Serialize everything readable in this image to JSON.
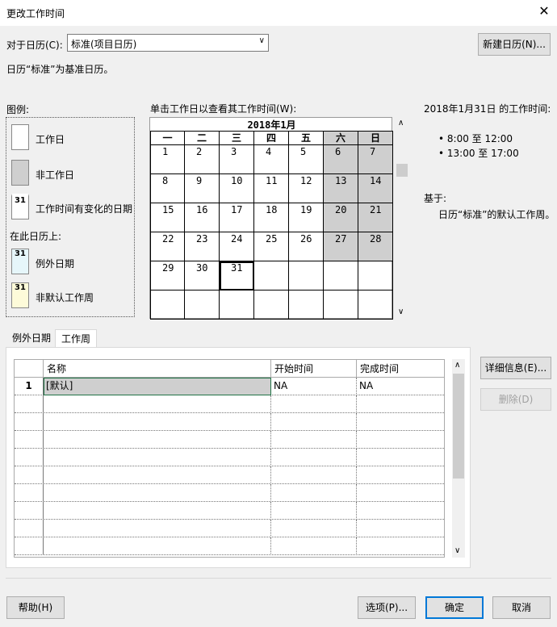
{
  "dialog": {
    "title": "更改工作时间",
    "close_glyph": "✕"
  },
  "calendar_select": {
    "label": "对于日历(C):",
    "value": "标准(项目日历)"
  },
  "new_calendar_button": "新建日历(N)...",
  "base_note": "日历“标准”为基准日历。",
  "legend": {
    "title": "图例:",
    "items": [
      {
        "label": "工作日",
        "mark": ""
      },
      {
        "label": "非工作日",
        "mark": ""
      },
      {
        "label": "工作时间有变化的日期",
        "mark": "31"
      }
    ],
    "on_calendar_label": "在此日历上:",
    "items2": [
      {
        "label": "例外日期",
        "mark": "31"
      },
      {
        "label": "非默认工作周",
        "mark": "31"
      }
    ]
  },
  "calendar": {
    "hint": "单击工作日以查看其工作时间(W):",
    "month_title": "2018年1月",
    "weekdays": [
      "一",
      "二",
      "三",
      "四",
      "五",
      "六",
      "日"
    ],
    "weeks": [
      [
        "1",
        "2",
        "3",
        "4",
        "5",
        "6",
        "7"
      ],
      [
        "8",
        "9",
        "10",
        "11",
        "12",
        "13",
        "14"
      ],
      [
        "15",
        "16",
        "17",
        "18",
        "19",
        "20",
        "21"
      ],
      [
        "22",
        "23",
        "24",
        "25",
        "26",
        "27",
        "28"
      ],
      [
        "29",
        "30",
        "31",
        "",
        "",
        "",
        ""
      ],
      [
        "",
        "",
        "",
        "",
        "",
        "",
        ""
      ]
    ],
    "selected_day": "31"
  },
  "work_times": {
    "title": "2018年1月31日 的工作时间:",
    "ranges": [
      "8:00 至 12:00",
      "13:00 至 17:00"
    ],
    "based_on_label": "基于:",
    "based_on_text": "日历“标准”的默认工作周。"
  },
  "tabs": [
    "例外日期",
    "工作周"
  ],
  "active_tab": "工作周",
  "grid": {
    "columns": [
      "名称",
      "开始时间",
      "完成时间"
    ],
    "rows": [
      {
        "num": "1",
        "name": "[默认]",
        "start": "NA",
        "finish": "NA"
      }
    ]
  },
  "side_buttons": {
    "details": "详细信息(E)...",
    "delete": "删除(D)"
  },
  "footer": {
    "help": "帮助(H)",
    "options": "选项(P)...",
    "ok": "确定",
    "cancel": "取消"
  },
  "colors": {
    "nonworking": "#cfcfcf",
    "accent": "#0078d7"
  }
}
